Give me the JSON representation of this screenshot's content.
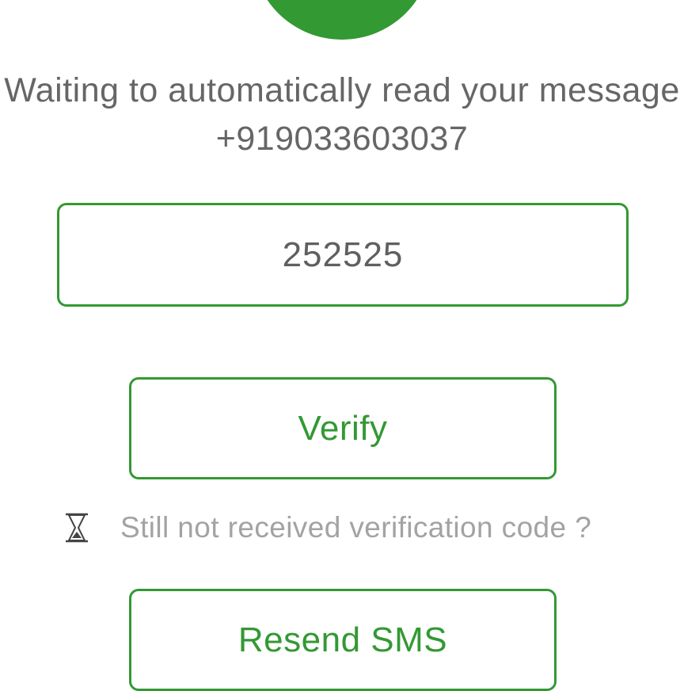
{
  "brand": {
    "color": "#339933"
  },
  "message": {
    "line1": "Waiting to automatically read your message",
    "phone": "+919033603037"
  },
  "code_field": {
    "value": "252525"
  },
  "buttons": {
    "verify_label": "Verify",
    "resend_label": "Resend SMS"
  },
  "hint": {
    "icon": "hourglass-icon",
    "text": "Still not received verification code ?"
  }
}
